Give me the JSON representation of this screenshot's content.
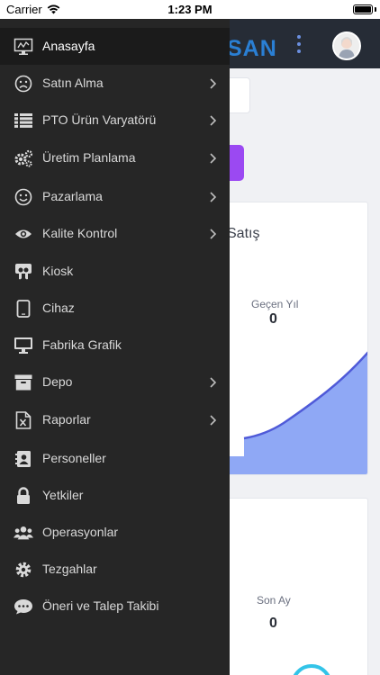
{
  "status_bar": {
    "carrier": "Carrier",
    "time": "1:23 PM",
    "battery_level": 1.0
  },
  "header": {
    "brand_partial": "SAN"
  },
  "sales_card": {
    "title_partial": "Satış",
    "last_year_label": "Geçen Yıl",
    "last_year_value": "0"
  },
  "second_card": {
    "last_month_label": "Son Ay",
    "last_month_value": "0"
  },
  "menu": {
    "items": [
      {
        "label": "Anasayfa",
        "icon": "monitor-chart-icon",
        "has_submenu": false,
        "active": true
      },
      {
        "label": "Satın Alma",
        "icon": "frown-face-icon",
        "has_submenu": true,
        "active": false
      },
      {
        "label": "PTO Ürün Varyatörü",
        "icon": "list-icon",
        "has_submenu": true,
        "active": false
      },
      {
        "label": "Üretim Planlama",
        "icon": "gears-icon",
        "has_submenu": true,
        "active": false
      },
      {
        "label": "Pazarlama",
        "icon": "smile-face-icon",
        "has_submenu": true,
        "active": false
      },
      {
        "label": "Kalite Kontrol",
        "icon": "eye-icon",
        "has_submenu": true,
        "active": false
      },
      {
        "label": "Kiosk",
        "icon": "slideshare-icon",
        "has_submenu": false,
        "active": false
      },
      {
        "label": "Cihaz",
        "icon": "tablet-icon",
        "has_submenu": false,
        "active": false
      },
      {
        "label": "Fabrika Grafik",
        "icon": "desktop-icon",
        "has_submenu": false,
        "active": false
      },
      {
        "label": "Depo",
        "icon": "archive-icon",
        "has_submenu": true,
        "active": false
      },
      {
        "label": "Raporlar",
        "icon": "excel-file-icon",
        "has_submenu": true,
        "active": false
      },
      {
        "label": "Personeller",
        "icon": "contact-book-icon",
        "has_submenu": false,
        "active": false
      },
      {
        "label": "Yetkiler",
        "icon": "lock-icon",
        "has_submenu": false,
        "active": false
      },
      {
        "label": "Operasyonlar",
        "icon": "users-icon",
        "has_submenu": false,
        "active": false
      },
      {
        "label": "Tezgahlar",
        "icon": "gear-icon",
        "has_submenu": false,
        "active": false
      },
      {
        "label": "Öneri ve Talep Takibi",
        "icon": "comment-icon",
        "has_submenu": false,
        "active": false
      }
    ]
  },
  "colors": {
    "drawer_bg": "#262626",
    "active_item_bg": "#1b1b1b",
    "topbar_bg": "#262c36",
    "brand": "#2a7fd4",
    "accent_purple": "#9b49f2",
    "chart_fill": "#8fa8f5",
    "chart_line": "#4f5ad8"
  }
}
